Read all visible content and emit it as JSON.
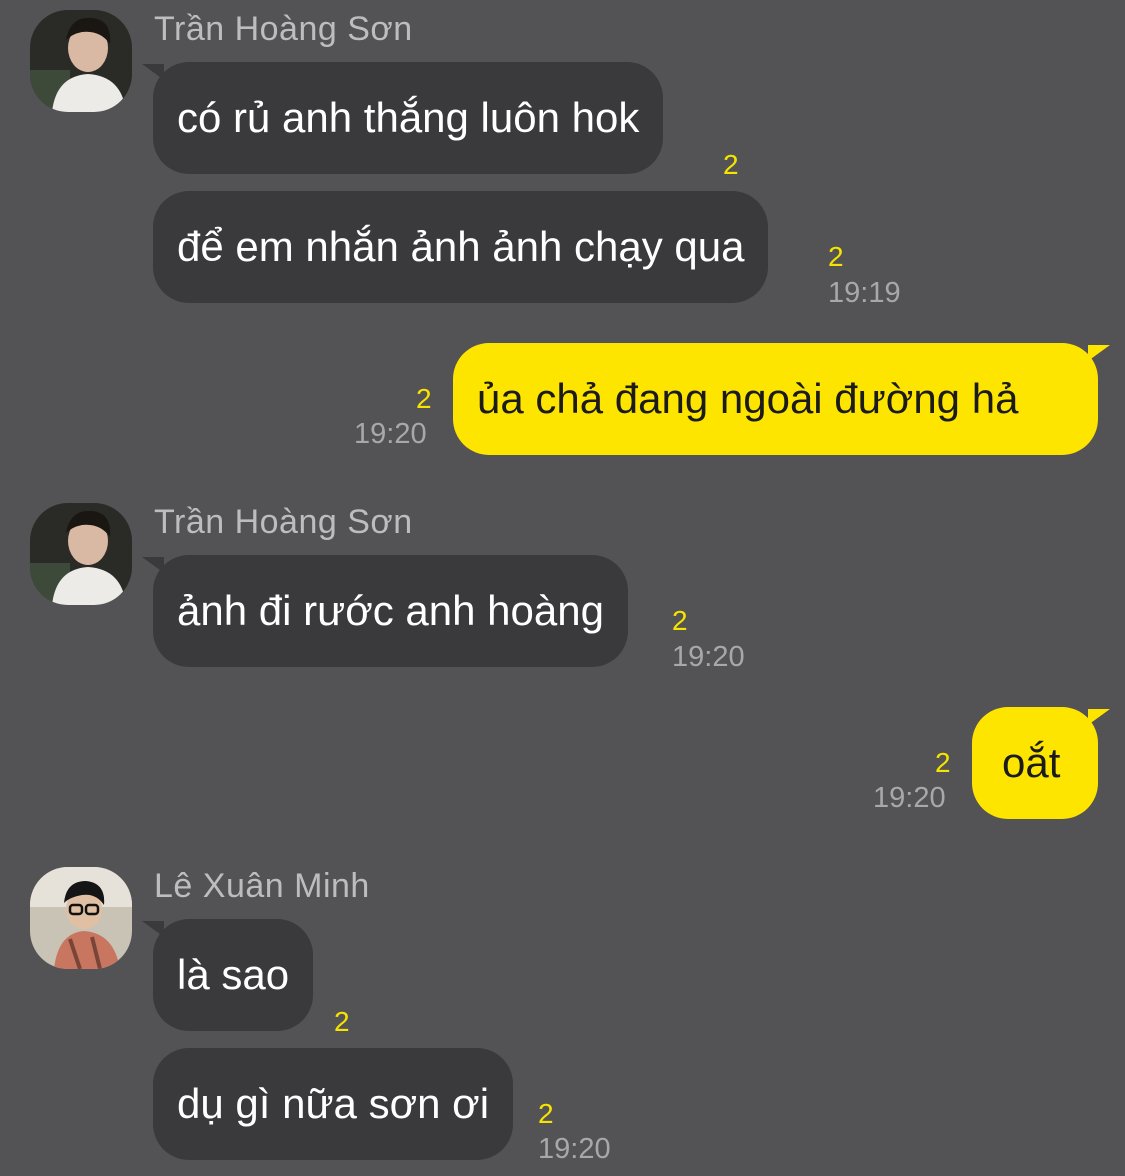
{
  "colors": {
    "background": "#535254",
    "incoming_bubble": "#3a393b",
    "outgoing_bubble": "#fee500",
    "unread": "#f5e300",
    "time": "#a8a8aa",
    "sender_name": "#bdbdbf"
  },
  "senders": {
    "son": {
      "name": "Trần Hoàng Sơn",
      "avatar_icon": "profile-photo-icon"
    },
    "minh": {
      "name": "Lê Xuân Minh",
      "avatar_icon": "profile-photo-icon"
    }
  },
  "messages": [
    {
      "direction": "in",
      "sender": "Trần Hoàng Sơn",
      "text": "có rủ anh thắng luôn hok",
      "unread": "2",
      "time": ""
    },
    {
      "direction": "in",
      "text": "để em nhắn ảnh ảnh chạy qua",
      "unread": "2",
      "time": "19:19"
    },
    {
      "direction": "out",
      "text": "ủa chả đang ngoài đường hả",
      "unread": "2",
      "time": "19:20"
    },
    {
      "direction": "in",
      "sender": "Trần Hoàng Sơn",
      "text": "ảnh đi rước anh hoàng",
      "unread": "2",
      "time": "19:20"
    },
    {
      "direction": "out",
      "text": "oắt",
      "unread": "2",
      "time": "19:20"
    },
    {
      "direction": "in",
      "sender": "Lê Xuân Minh",
      "text": "là sao",
      "unread": "2",
      "time": ""
    },
    {
      "direction": "in",
      "text": "dụ gì nữa sơn ơi",
      "unread": "2",
      "time": "19:20"
    }
  ]
}
